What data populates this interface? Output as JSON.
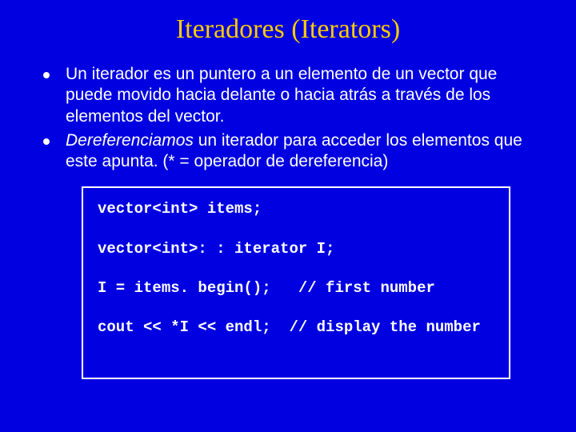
{
  "title": "Iteradores (Iterators)",
  "bullets": [
    {
      "text": "Un iterador es un puntero a un elemento de un vector que puede movido hacia delante o hacia atrás a través de los elementos del vector."
    },
    {
      "lead_italic": "Dereferenciamos",
      "rest": " un iterador para acceder los elementos que este apunta. (* = operador de dereferencia)"
    }
  ],
  "code": "vector<int> items;\n\nvector<int>: : iterator I;\n\nI = items. begin();   // first number\n\ncout << *I << endl;  // display the number"
}
